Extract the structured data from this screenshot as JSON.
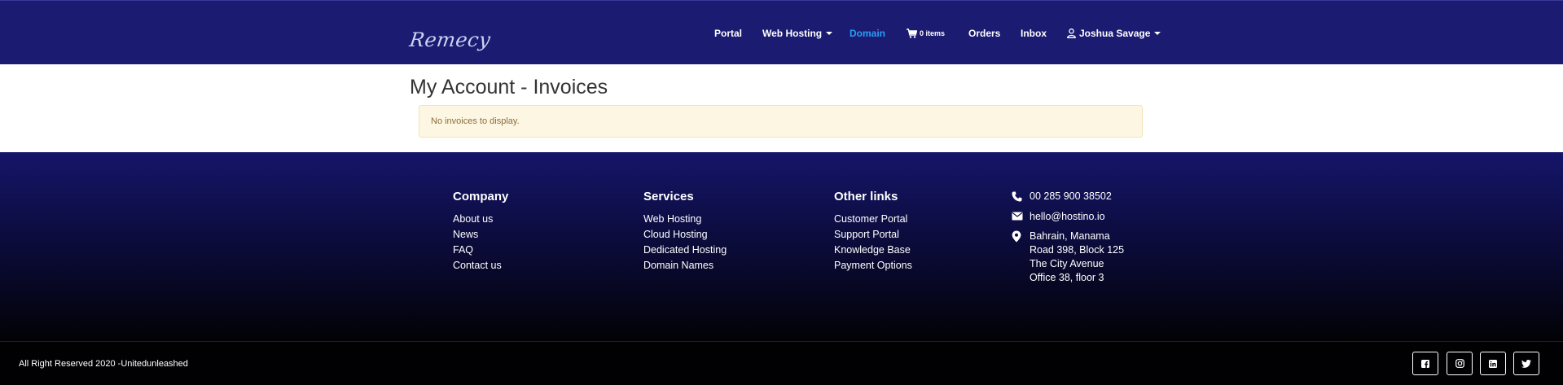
{
  "brand": {
    "logo_text": "Remecy"
  },
  "nav": {
    "portal": "Portal",
    "web_hosting": "Web Hosting",
    "domain": "Domain",
    "cart_count": "0 items",
    "orders": "Orders",
    "inbox": "Inbox",
    "user": "Joshua Savage",
    "active": "Domain",
    "active_color": "#2a9df4"
  },
  "main": {
    "title": "My Account - Invoices",
    "empty_message": "No invoices to display."
  },
  "footer": {
    "company": {
      "heading": "Company",
      "links": [
        "About us",
        "News",
        "FAQ",
        "Contact us"
      ]
    },
    "services": {
      "heading": "Services",
      "links": [
        "Web Hosting",
        "Cloud Hosting",
        "Dedicated Hosting",
        "Domain Names"
      ]
    },
    "other": {
      "heading": "Other links",
      "links": [
        "Customer Portal",
        "Support Portal",
        "Knowledge Base",
        "Payment Options"
      ]
    },
    "contact": {
      "phone": "00 285 900 38502",
      "email": "hello@hostino.io",
      "address": [
        "Bahrain, Manama",
        "Road 398, Block 125",
        "The City Avenue",
        "Office 38, floor 3"
      ]
    }
  },
  "bottom": {
    "copyright": "All Right Reserved 2020 -Unitedunleashed",
    "social_icons": [
      "facebook-icon",
      "instagram-icon",
      "linkedin-icon",
      "twitter-icon"
    ]
  },
  "colors": {
    "header_bg": "#1b1b72",
    "alert_bg": "#fdf6e3",
    "alert_text": "#8a6d3b"
  }
}
